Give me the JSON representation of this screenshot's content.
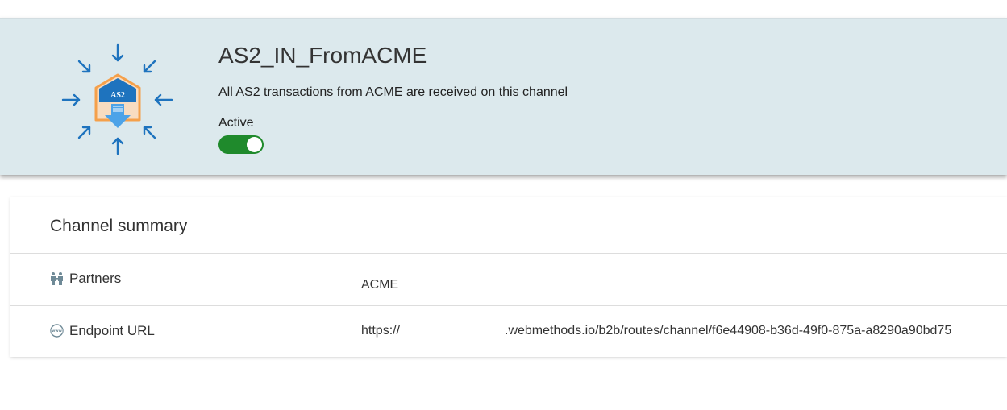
{
  "channel": {
    "title": "AS2_IN_FromACME",
    "description": "All AS2 transactions from ACME are received on this channel",
    "active_label": "Active",
    "active": true,
    "icon": "as2-inbound-channel-icon",
    "icon_badge_text": "AS2"
  },
  "summary": {
    "title": "Channel summary",
    "rows": [
      {
        "label": "Partners",
        "icon": "partners-icon",
        "value": "ACME"
      },
      {
        "label": "Endpoint URL",
        "icon": "globe-www-icon",
        "value_prefix": "https://",
        "value_suffix": ".webmethods.io/b2b/routes/channel/f6e44908-b36d-49f0-875a-a8290a90bd75"
      }
    ]
  },
  "colors": {
    "header_bg": "#dce9ed",
    "toggle_on": "#1f8a2c",
    "icon_blue": "#1e73be",
    "icon_orange": "#f5a04a"
  }
}
